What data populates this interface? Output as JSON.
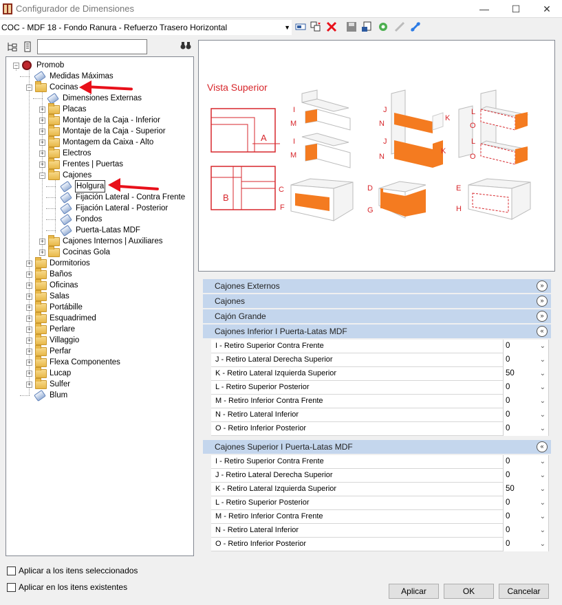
{
  "window": {
    "title": "Configurador de Dimensiones",
    "minimize": "—",
    "maximize": "☐",
    "close": "✕"
  },
  "toolbar": {
    "preset": "COC - MDF 18 - Fondo Ranura - Refuerzo Trasero Horizontal"
  },
  "tree": [
    {
      "label": "Promob",
      "level": 0,
      "icon": "root",
      "exp": "−"
    },
    {
      "label": "Medidas Máximas",
      "level": 1,
      "icon": "leaf"
    },
    {
      "label": "Cocinas",
      "level": 1,
      "icon": "folder",
      "exp": "−"
    },
    {
      "label": "Dimensiones Externas",
      "level": 2,
      "icon": "leaf"
    },
    {
      "label": "Placas",
      "level": 2,
      "icon": "folder",
      "exp": "+"
    },
    {
      "label": "Montaje de la Caja - Inferior",
      "level": 2,
      "icon": "folder",
      "exp": "+"
    },
    {
      "label": "Montaje de la Caja - Superior",
      "level": 2,
      "icon": "folder",
      "exp": "+"
    },
    {
      "label": "Montagem da Caixa - Alto",
      "level": 2,
      "icon": "folder",
      "exp": "+"
    },
    {
      "label": "Electros",
      "level": 2,
      "icon": "folder",
      "exp": "+"
    },
    {
      "label": "Frentes | Puertas",
      "level": 2,
      "icon": "folder",
      "exp": "+"
    },
    {
      "label": "Cajones",
      "level": 2,
      "icon": "folder",
      "exp": "−"
    },
    {
      "label": "Holgura",
      "level": 3,
      "icon": "leaf"
    },
    {
      "label": "Fijación Lateral - Contra Frente",
      "level": 3,
      "icon": "leaf"
    },
    {
      "label": "Fijación Lateral - Posterior",
      "level": 3,
      "icon": "leaf"
    },
    {
      "label": "Fondos",
      "level": 3,
      "icon": "leaf"
    },
    {
      "label": "Puerta-Latas MDF",
      "level": 3,
      "icon": "leaf"
    },
    {
      "label": "Cajones Internos | Auxiliares",
      "level": 2,
      "icon": "folder",
      "exp": "+"
    },
    {
      "label": "Cocinas Gola",
      "level": 2,
      "icon": "folder",
      "exp": "+"
    },
    {
      "label": "Dormitorios",
      "level": 1,
      "icon": "folder",
      "exp": "+"
    },
    {
      "label": "Baños",
      "level": 1,
      "icon": "folder",
      "exp": "+"
    },
    {
      "label": "Oficinas",
      "level": 1,
      "icon": "folder",
      "exp": "+"
    },
    {
      "label": "Salas",
      "level": 1,
      "icon": "folder",
      "exp": "+"
    },
    {
      "label": "Portábille",
      "level": 1,
      "icon": "folder",
      "exp": "+"
    },
    {
      "label": "Esquadrimed",
      "level": 1,
      "icon": "folder",
      "exp": "+"
    },
    {
      "label": "Perlare",
      "level": 1,
      "icon": "folder",
      "exp": "+"
    },
    {
      "label": "Villaggio",
      "level": 1,
      "icon": "folder",
      "exp": "+"
    },
    {
      "label": "Perfar",
      "level": 1,
      "icon": "folder",
      "exp": "+"
    },
    {
      "label": "Flexa Componentes",
      "level": 1,
      "icon": "folder",
      "exp": "+"
    },
    {
      "label": "Lucap",
      "level": 1,
      "icon": "folder",
      "exp": "+"
    },
    {
      "label": "Sulfer",
      "level": 1,
      "icon": "folder",
      "exp": "+"
    },
    {
      "label": "Blum",
      "level": 1,
      "icon": "leaf"
    }
  ],
  "preview": {
    "title": "Vista Superior",
    "letters": [
      "A",
      "B",
      "C",
      "D",
      "E",
      "F",
      "G",
      "H",
      "I",
      "J",
      "K",
      "L",
      "M",
      "N",
      "O"
    ]
  },
  "sections": [
    {
      "title": "Cajones Externos",
      "chev": "»"
    },
    {
      "title": "Cajones",
      "chev": "»"
    },
    {
      "title": "Cajón Grande",
      "chev": "»"
    },
    {
      "title": "Cajones Inferior I Puerta-Latas MDF",
      "chev": "«"
    },
    {
      "title": "Cajones Superior I Puerta-Latas MDF",
      "chev": "«"
    }
  ],
  "rows_inferior": [
    {
      "label": "I - Retiro Superior Contra Frente",
      "value": "0"
    },
    {
      "label": "J - Retiro Lateral Derecha Superior",
      "value": "0"
    },
    {
      "label": "K - Retiro Lateral Izquierda Superior",
      "value": "50"
    },
    {
      "label": "L - Retiro Superior Posterior",
      "value": "0"
    },
    {
      "label": "M - Retiro Inferior Contra Frente",
      "value": "0"
    },
    {
      "label": "N - Retiro Lateral Inferior",
      "value": "0"
    },
    {
      "label": "O - Retiro Inferior Posterior",
      "value": "0"
    }
  ],
  "rows_superior": [
    {
      "label": "I - Retiro Superior Contra Frente",
      "value": "0"
    },
    {
      "label": "J - Retiro Lateral Derecha Superior",
      "value": "0"
    },
    {
      "label": "K - Retiro Lateral Izquierda Superior",
      "value": "50"
    },
    {
      "label": "L - Retiro Superior Posterior",
      "value": "0"
    },
    {
      "label": "M - Retiro Inferior Contra Frente",
      "value": "0"
    },
    {
      "label": "N - Retiro Lateral Inferior",
      "value": "0"
    },
    {
      "label": "O - Retiro Inferior Posterior",
      "value": "0"
    }
  ],
  "options": {
    "apply_selected": "Aplicar a los itens seleccionados",
    "apply_existing": "Aplicar en los itens existentes"
  },
  "buttons": {
    "apply": "Aplicar",
    "ok": "OK",
    "cancel": "Cancelar"
  },
  "colors": {
    "accent_red": "#e8101a",
    "orange": "#f47b20",
    "section_bg": "#c4d6ed"
  }
}
